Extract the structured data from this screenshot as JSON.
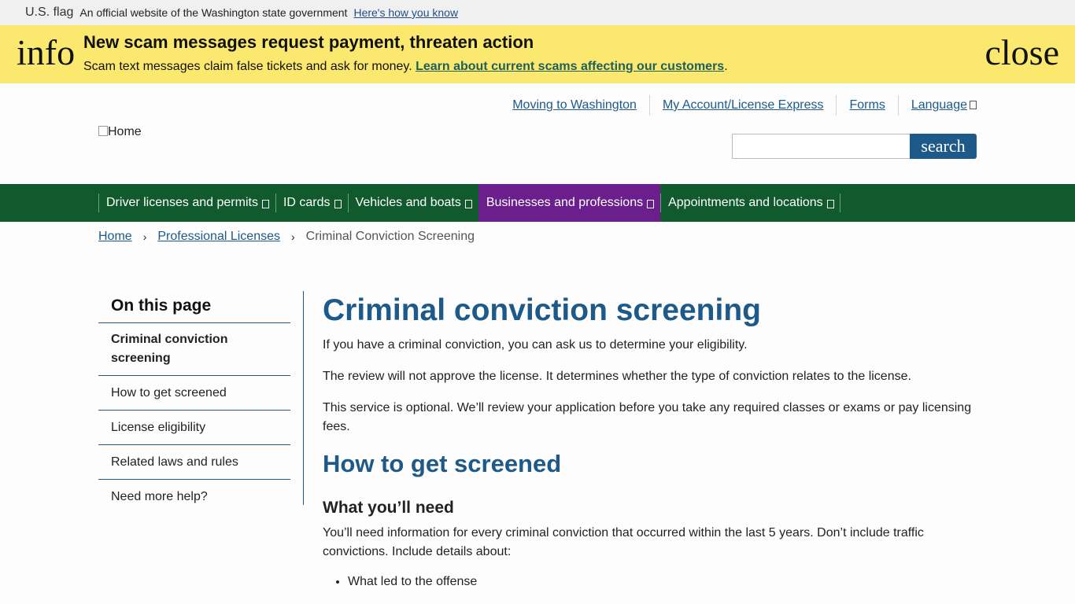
{
  "gov_banner": {
    "flag_alt": "U.S. flag",
    "text": "An official website of the Washington state government",
    "link": "Here's how you know"
  },
  "alert": {
    "icon_text": "info",
    "title": "New scam messages request payment, threaten action",
    "body": "Scam text messages claim false tickets and ask for money.",
    "link": "Learn about current scams affecting our customers",
    "trailing": ".",
    "close_text": "close"
  },
  "header": {
    "logo_alt": "Home",
    "util_links": [
      "Moving to Washington",
      "My Account/License Express",
      "Forms",
      "Language"
    ],
    "search_button": "search"
  },
  "main_nav": {
    "items": [
      "Driver licenses and permits",
      "ID cards",
      "Vehicles and boats",
      "Businesses and professions",
      "Appointments and locations"
    ],
    "active": "Businesses and professions"
  },
  "breadcrumb": {
    "home": "Home",
    "section": "Professional Licenses",
    "current": "Criminal Conviction Screening"
  },
  "sidebar": {
    "title": "On this page",
    "items": [
      "Criminal conviction screening",
      "How to get screened",
      "License eligibility",
      "Related laws and rules",
      "Need more help?"
    ]
  },
  "content": {
    "h1": "Criminal conviction screening",
    "p1": "If you have a criminal conviction, you can ask us to determine your eligibility.",
    "p2": "The review will not approve the license. It determines whether the type of conviction relates to the license.",
    "p3": "This service is optional. We’ll review your application before you take any required classes or exams or pay licensing fees.",
    "h2": "How to get screened",
    "h3": "What you’ll need",
    "p4": "You’ll need information for every criminal conviction that occurred within the last 5 years. Don’t include traffic convictions. Include details about:",
    "bullets": [
      "What led to the offense"
    ]
  },
  "colors": {
    "alert_bg": "#fbe96f",
    "nav_bg": "#115a2e",
    "nav_active": "#6b1f8c",
    "link": "#1d5a8a"
  }
}
